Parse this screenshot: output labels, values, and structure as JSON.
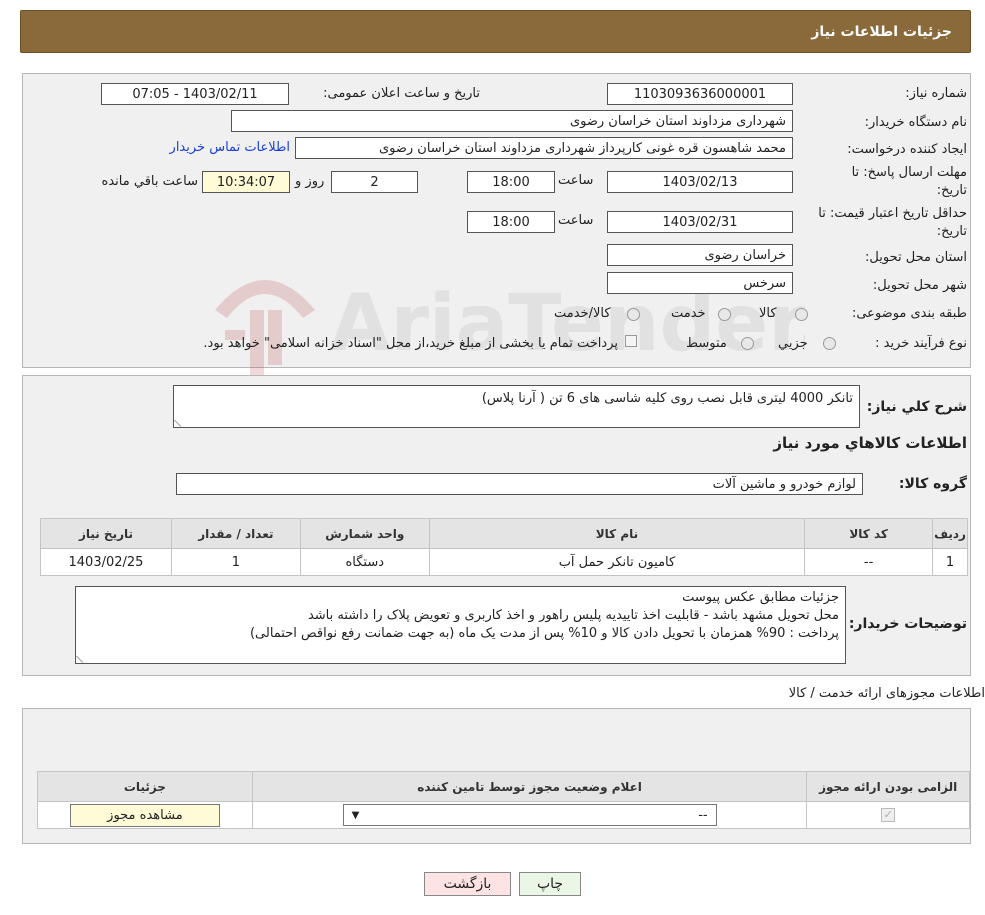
{
  "header": {
    "title": "جزئیات اطلاعات نیاز"
  },
  "form": {
    "need_number_label": "شماره نیاز:",
    "need_number": "1103093636000001",
    "announce_label": "تاریخ و ساعت اعلان عمومی:",
    "announce_value": "1403/02/11 - 07:05",
    "buyer_org_label": "نام دستگاه خریدار:",
    "buyer_org": "شهرداری مزداوند استان خراسان رضوی",
    "creator_label": "ایجاد کننده درخواست:",
    "creator": "محمد شاهسون قره غونی کارپرداز شهرداری مزداوند استان خراسان رضوی",
    "contact_link": "اطلاعات تماس خریدار",
    "deadline_label_1": "مهلت ارسال پاسخ: تا",
    "deadline_label_2": "تاریخ:",
    "deadline_date": "1403/02/13",
    "time_label": "ساعت",
    "deadline_time": "18:00",
    "days_value": "2",
    "days_label": "روز و",
    "remaining_time": "10:34:07",
    "remaining_label": "ساعت باقي مانده",
    "validity_label_1": "حداقل تاریخ اعتبار قیمت: تا",
    "validity_label_2": "تاریخ:",
    "validity_date": "1403/02/31",
    "validity_time": "18:00",
    "province_label": "استان محل تحویل:",
    "province": "خراسان رضوی",
    "city_label": "شهر محل تحویل:",
    "city": "سرخس",
    "category_label": "طبقه بندی موضوعی:",
    "category_options": [
      "کالا",
      "خدمت",
      "کالا/خدمت"
    ],
    "process_label": "نوع فرآیند خرید :",
    "process_options": [
      "جزیي",
      "متوسط"
    ],
    "process_note": "پرداخت تمام یا بخشی از مبلغ خرید،از محل \"اسناد خزانه اسلامی\" خواهد بود."
  },
  "description": {
    "summary_label": "شرح کلي نیاز:",
    "summary": "تانکر 4000 لیتری قابل نصب روی کلیه شاسی های 6 تن ( آرنا پلاس)",
    "goods_info_title": "اطلاعات کالاهاي مورد نیاز",
    "group_label": "گروه کالا:",
    "group_value": "لوازم خودرو و ماشین آلات",
    "table": {
      "headers": [
        "ردیف",
        "کد کالا",
        "نام کالا",
        "واحد شمارش",
        "تعداد / مقدار",
        "تاریخ نیاز"
      ],
      "rows": [
        [
          "1",
          "--",
          "کامیون تانکر حمل آب",
          "دستگاه",
          "1",
          "1403/02/25"
        ]
      ]
    },
    "buyer_notes_label": "توضیحات خریدار:",
    "buyer_notes": [
      "جزئیات مطابق عکس پیوست",
      "محل تحویل مشهد باشد - قابلیت اخذ تاییدیه پلیس راهور و اخذ کاربری و تعویض پلاک را داشته باشد",
      "پرداخت : 90% همزمان با تحویل دادن کالا و 10% پس از مدت یک ماه (به جهت ضمانت رفع نواقص احتمالی)"
    ]
  },
  "permits": {
    "title": "اطلاعات مجوزهای ارائه خدمت / کالا",
    "headers": [
      "الزامی بودن ارائه مجوز",
      "اعلام وضعیت مجوز توسط تامین کننده",
      "جزئیات"
    ],
    "select_value": "--",
    "view_button": "مشاهده مجوز"
  },
  "buttons": {
    "print": "چاپ",
    "back": "بازگشت"
  },
  "watermark": {
    "text": "AriaTender.neT"
  }
}
